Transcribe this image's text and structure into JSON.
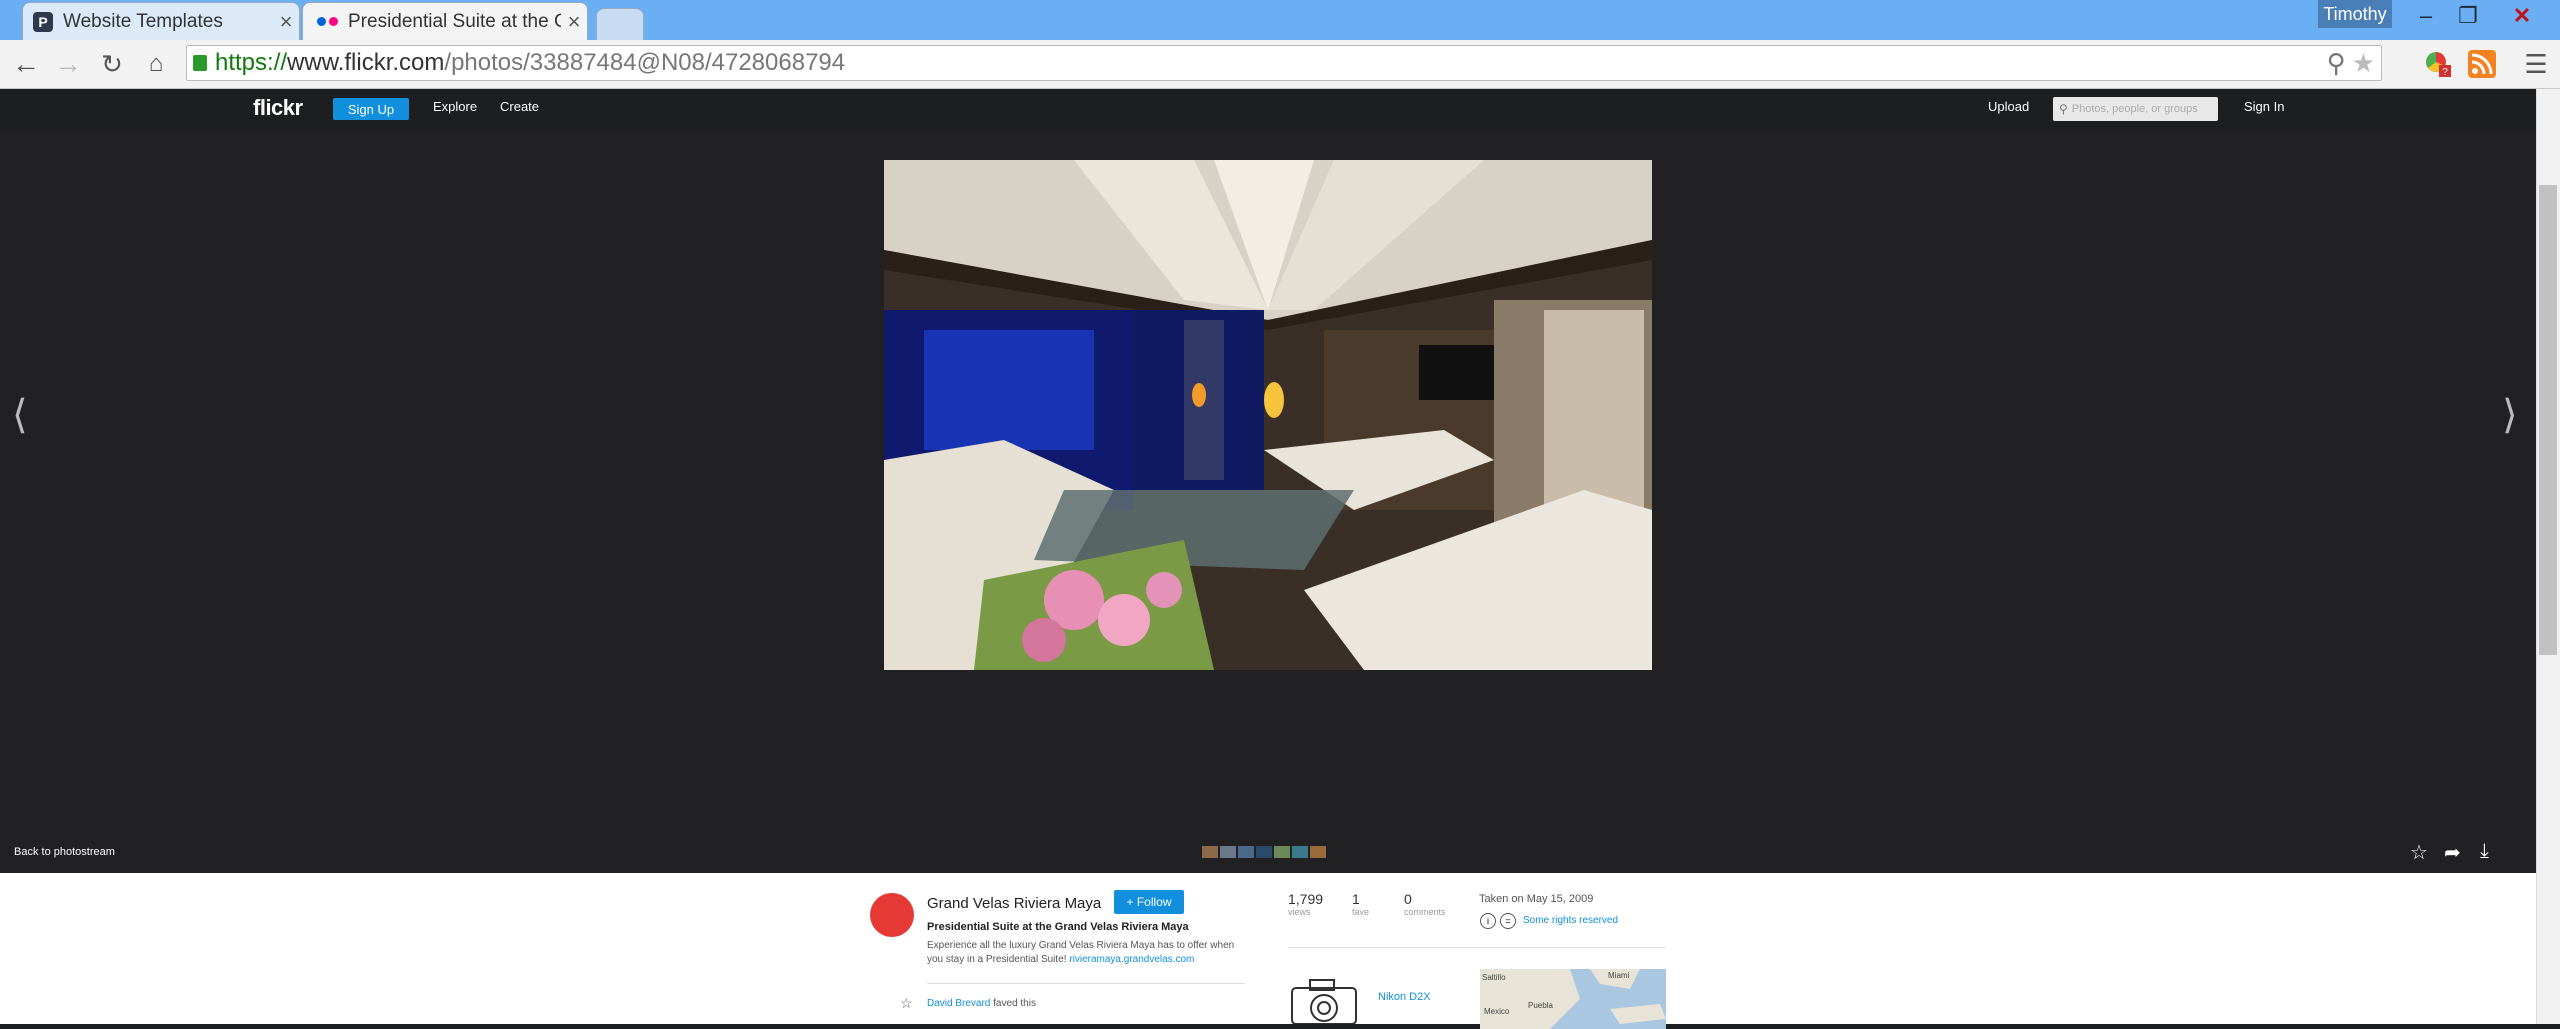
{
  "browser": {
    "tabs": [
      {
        "label": "Website Templates",
        "close": "×"
      },
      {
        "label": "Presidential Suite at the G",
        "close": "×"
      }
    ],
    "user": "Timothy",
    "url": {
      "scheme": "https://",
      "host": "www.flickr.com",
      "path": "/photos/33887484@N08/4728068794"
    }
  },
  "header": {
    "logo": "flickr",
    "signup": "Sign Up",
    "explore": "Explore",
    "create": "Create",
    "upload": "Upload",
    "search_placeholder": "Photos, people, or groups",
    "signin": "Sign In"
  },
  "viewer": {
    "back_link": "Back to photostream"
  },
  "owner": {
    "name": "Grand Velas Riviera Maya",
    "follow": "+ Follow",
    "title": "Presidential Suite at the Grand Velas Riviera Maya",
    "description": "Experience all the luxury Grand Velas Riviera Maya has to offer when you stay in a Presidential Suite!",
    "link": "rivieramaya.grandvelas.com",
    "fave_user": "David Brevard",
    "fave_text": "faved this"
  },
  "stats": {
    "views_count": "1,799",
    "views_label": "views",
    "faves_count": "1",
    "faves_label": "fave",
    "comments_count": "0",
    "comments_label": "comments",
    "taken": "Taken on May 15, 2009",
    "license": "Some rights reserved",
    "camera": "Nikon D2X"
  },
  "map": {
    "labels": [
      "Saltillo",
      "Miami",
      "Mexico",
      "Puebla"
    ]
  }
}
